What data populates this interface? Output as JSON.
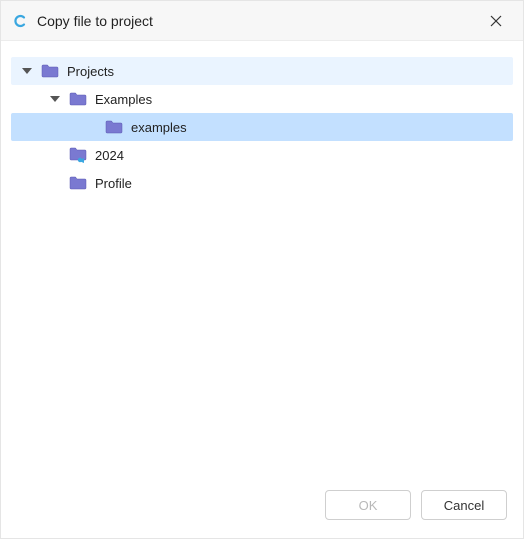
{
  "window": {
    "title": "Copy file to project",
    "app_icon_letter": "C"
  },
  "tree": {
    "root": {
      "label": "Projects",
      "expanded": true
    },
    "nodes": [
      {
        "label": "Examples",
        "expanded": true,
        "depth": 2,
        "icon": "folder"
      },
      {
        "label": "examples",
        "selected": true,
        "depth": 3,
        "icon": "folder"
      },
      {
        "label": "2024",
        "depth": 2,
        "icon": "folder-link"
      },
      {
        "label": "Profile",
        "depth": 2,
        "icon": "folder"
      }
    ]
  },
  "buttons": {
    "ok": "OK",
    "cancel": "Cancel"
  }
}
